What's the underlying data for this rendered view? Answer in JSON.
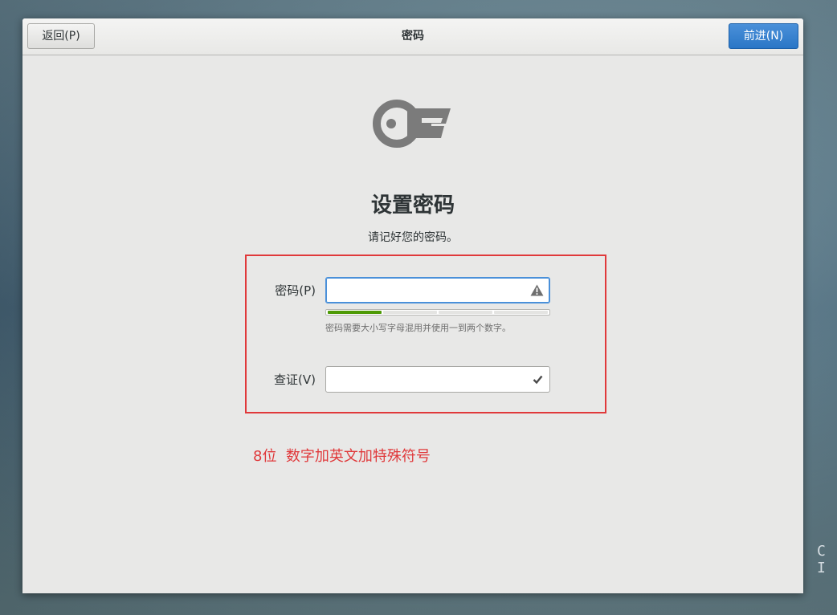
{
  "header": {
    "back_label": "返回(P)",
    "title": "密码",
    "next_label": "前进(N)"
  },
  "main": {
    "title": "设置密码",
    "subtitle": "请记好您的密码。"
  },
  "form": {
    "password_label": "密码(P)",
    "password_value": "",
    "password_status_icon": "warning-icon",
    "strength_level": 0.25,
    "hint": "密码需要大小写字母混用并使用一到两个数字。",
    "verify_label": "查证(V)",
    "verify_value": "",
    "verify_status_icon": "check-icon"
  },
  "annotation": {
    "text": "8位  数字加英文加特殊符号",
    "color": "#e0393b"
  },
  "desktop": {
    "corner_text": "C I"
  },
  "colors": {
    "accent": "#4a90d9",
    "strength_fill": "#4e9a06"
  }
}
